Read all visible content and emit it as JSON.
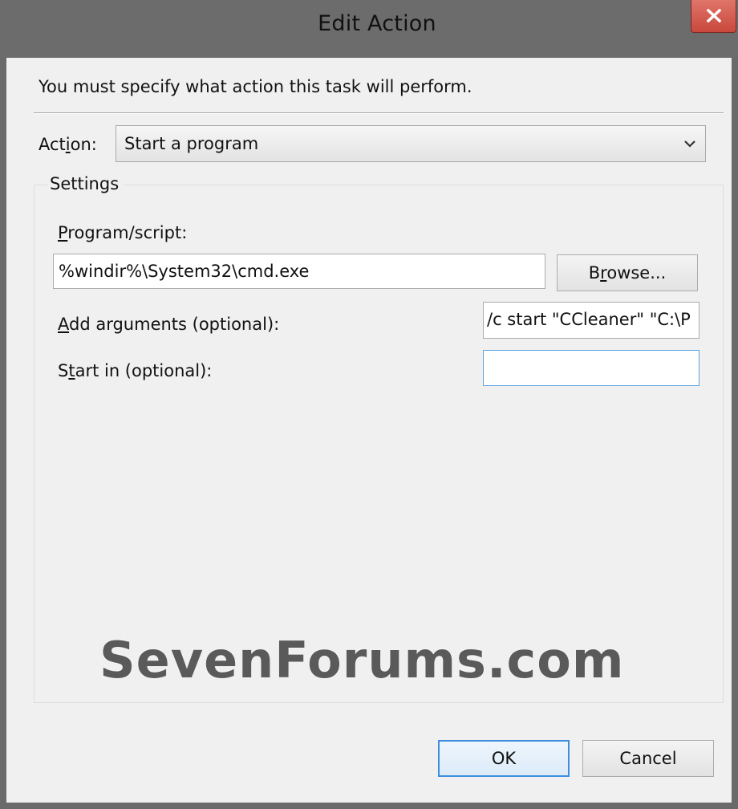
{
  "window": {
    "title": "Edit Action",
    "close_icon": "close-icon"
  },
  "instruction": "You must specify what action this task will perform.",
  "action": {
    "label_pre": "Act",
    "label_accel": "i",
    "label_post": "on:",
    "selected": "Start a program",
    "dropdown_icon": "chevron-down-icon"
  },
  "settings": {
    "legend": "Settings",
    "program": {
      "label_accel": "P",
      "label_rest": "rogram/script:",
      "value": "%windir%\\System32\\cmd.exe"
    },
    "browse": {
      "pre": "B",
      "accel": "r",
      "post": "owse..."
    },
    "arguments": {
      "label_accel": "A",
      "label_rest": "dd arguments (optional):",
      "value": "/c start \"CCleaner\" \"C:\\P"
    },
    "start_in": {
      "label_pre": "S",
      "label_accel": "t",
      "label_post": "art in (optional):",
      "value": ""
    }
  },
  "buttons": {
    "ok": "OK",
    "cancel": "Cancel"
  },
  "watermark": "SevenForums.com",
  "colors": {
    "titlebar": "#6c6c6c",
    "client": "#f0f0f0",
    "close_button": "#c9483c",
    "default_button_border": "#3d8ee0",
    "focus_border": "#5aa4e0"
  }
}
